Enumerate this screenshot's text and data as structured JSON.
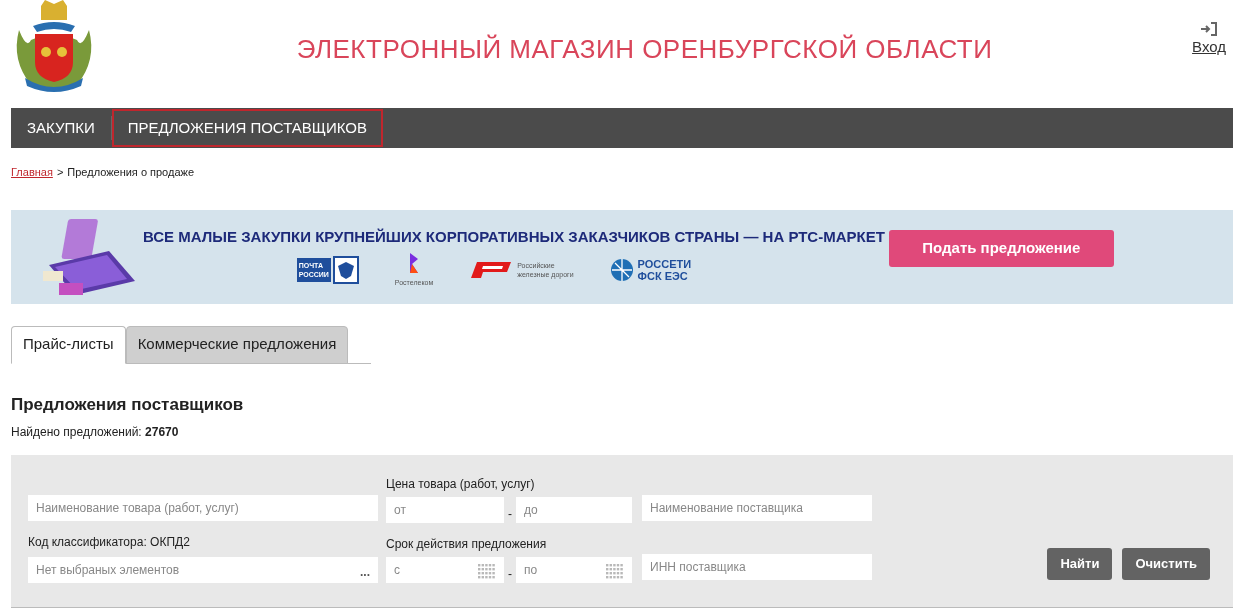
{
  "header": {
    "title": "ЭЛЕКТРОННЫЙ МАГАЗИН ОРЕНБУРГСКОЙ ОБЛАСТИ",
    "login": "Вход"
  },
  "nav": [
    {
      "label": "ЗАКУПКИ",
      "selected": false
    },
    {
      "label": "ПРЕДЛОЖЕНИЯ ПОСТАВЩИКОВ",
      "selected": true
    }
  ],
  "breadcrumb": {
    "link": "Главная",
    "separator": ">",
    "current": "Предложения о продаже"
  },
  "banner": {
    "headline": "ВСЕ МАЛЫЕ ЗАКУПКИ КРУПНЕЙШИХ КОРПОРАТИВНЫХ ЗАКАЗЧИКОВ СТРАНЫ — НА РТС-МАРКЕТ",
    "button": "Подать предложение",
    "logos": [
      {
        "kind": "post",
        "lines": [
          "ПОЧТА",
          "РОССИИ"
        ]
      },
      {
        "kind": "rt",
        "lines": [
          "Ростелеком"
        ]
      },
      {
        "kind": "rzd",
        "lines": [
          "Российские",
          "железные дороги"
        ]
      },
      {
        "kind": "grid",
        "lines": [
          "РОССЕТИ",
          "ФСК ЕЭС"
        ]
      }
    ]
  },
  "tabs": [
    {
      "label": "Прайс-листы",
      "selected": true
    },
    {
      "label": "Коммерческие предложения",
      "selected": false
    }
  ],
  "heading": "Предложения поставщиков",
  "found": {
    "label": "Найдено предложений:",
    "count": "27670"
  },
  "filters": {
    "name": {
      "placeholder": "Наименование товара (работ, услуг)"
    },
    "price": {
      "label": "Цена товара (работ, услуг)",
      "from": {
        "placeholder": "от"
      },
      "to": {
        "placeholder": "до"
      },
      "dash": "-"
    },
    "supplier": {
      "placeholder": "Наименование поставщика"
    },
    "classifier": {
      "label": "Код классификатора: ОКПД2",
      "placeholder": "Нет выбраных элементов",
      "more": "..."
    },
    "period": {
      "label": "Срок действия предложения",
      "from": {
        "placeholder": "с"
      },
      "to": {
        "placeholder": "по"
      },
      "dash": "-"
    },
    "inn": {
      "placeholder": "ИНН поставщика"
    },
    "buttons": [
      "Найти",
      "Очистить"
    ]
  }
}
